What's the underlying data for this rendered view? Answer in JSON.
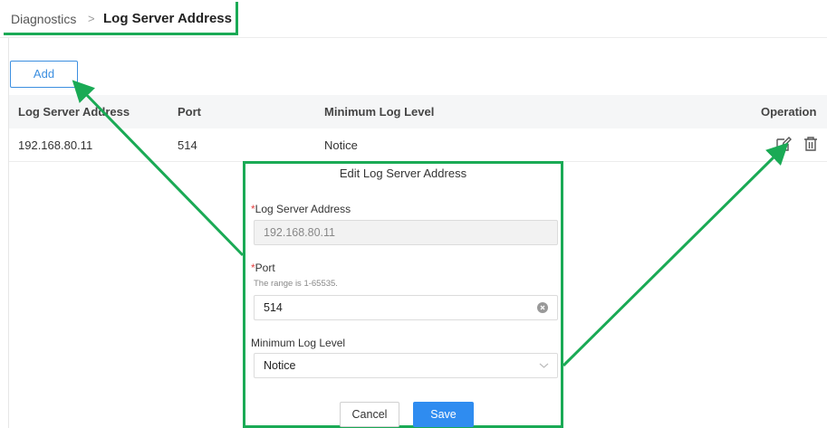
{
  "breadcrumb": {
    "parent": "Diagnostics",
    "separator": ">",
    "current": "Log Server Address"
  },
  "toolbar": {
    "add_label": "Add"
  },
  "table": {
    "headers": [
      "Log Server Address",
      "Port",
      "Minimum Log Level",
      "Operation"
    ],
    "rows": [
      {
        "address": "192.168.80.11",
        "port": "514",
        "level": "Notice"
      }
    ]
  },
  "dialog": {
    "title": "Edit Log Server Address",
    "address_label": "Log Server Address",
    "address_value": "192.168.80.11",
    "port_label": "Port",
    "port_hint": "The range is 1-65535.",
    "port_value": "514",
    "level_label": "Minimum Log Level",
    "level_value": "Notice",
    "required_mark": "*",
    "cancel_label": "Cancel",
    "save_label": "Save"
  },
  "icons": {
    "edit": "edit-icon",
    "delete": "delete-icon",
    "clear": "clear-icon",
    "dropdown": "chevron-down-icon"
  },
  "colors": {
    "accent": "#2f8cf0",
    "highlight": "#1aaa55",
    "required": "#e64545"
  }
}
